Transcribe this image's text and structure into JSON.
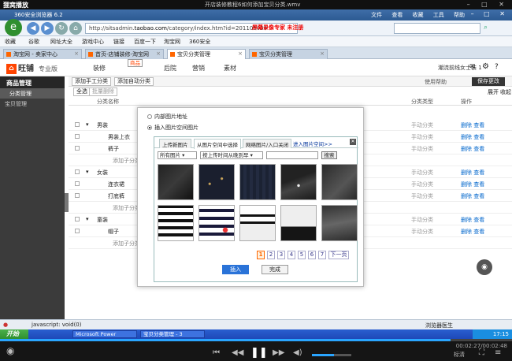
{
  "player": {
    "app_name": "狸窝播放",
    "title": "开店装修教程6如何添加宝贝分类.wmv",
    "time": "00:02:27/00:02:48",
    "progress": 0.88,
    "volume": 0.55,
    "quality_label": "标清"
  },
  "browser": {
    "title": "360安全浏览器 6.2",
    "menu": "文件 查看 收藏 工具 帮助",
    "url_prefix": "http://sitsadmin.",
    "url_host": "taobao.com",
    "url_rest": "/category/index.htm?id=201105038",
    "recording_label": "屏幕录像专家 未注册",
    "favorites": [
      "收藏",
      "谷歌",
      "网址大全",
      "游戏中心",
      "链接",
      "百度一下",
      "淘宝网",
      "360安全"
    ],
    "tabs": [
      {
        "label": "淘宝网 - 卖家中心"
      },
      {
        "label": "首页-店铺装修-淘宝网"
      },
      {
        "label": "宝贝分类管理"
      },
      {
        "label": "宝贝分类管理"
      }
    ]
  },
  "app": {
    "brand": "旺铺",
    "edition": "专业版",
    "nav": [
      "装修",
      "商品",
      "后院",
      "营销",
      "素材"
    ],
    "user": "潮流前线女士装 1",
    "sidebar": {
      "header": "商品管理",
      "items": [
        "分类管理",
        "宝贝管理"
      ]
    },
    "toolbar": {
      "add_manual": "添加手工分类",
      "add_auto": "添加自动分类",
      "help": "使用帮助",
      "save": "保存更改",
      "expand": "展开",
      "collapse": "收起"
    },
    "filter": {
      "all": "全选",
      "batch_delete": "批量删除"
    },
    "columns": {
      "name": "分类名称",
      "type": "分类类型",
      "ops": "操作"
    },
    "rows": [
      {
        "name": "男装",
        "type": "手动分类",
        "ops": "删除 查看"
      },
      {
        "name": "男装上衣",
        "type": "手动分类",
        "ops": "删除 查看"
      },
      {
        "name": "裤子",
        "type": "手动分类",
        "ops": "删除 查看"
      },
      {
        "name": "添加子分类",
        "type": "",
        "ops": ""
      },
      {
        "name": "女装",
        "type": "手动分类",
        "ops": "删除 查看"
      },
      {
        "name": "连衣裙",
        "type": "手动分类",
        "ops": "删除 查看"
      },
      {
        "name": "打底裤",
        "type": "手动分类",
        "ops": "删除 查看"
      },
      {
        "name": "添加子分类",
        "type": "",
        "ops": ""
      },
      {
        "name": "童装",
        "type": "手动分类",
        "ops": "删除 查看"
      },
      {
        "name": "帽子",
        "type": "手动分类",
        "ops": "删除 查看"
      },
      {
        "name": "添加子分类",
        "type": "",
        "ops": ""
      }
    ]
  },
  "dialog": {
    "radio_url": "内部图片地址",
    "radio_space": "插入图片空间图片",
    "tabs": [
      "上传新图片",
      "从图片空间中选择",
      "网络图片/入口关闭",
      "进入图片空间>>"
    ],
    "filter_all": "所有图片",
    "filter_sort": "按上传时间从晚到早",
    "search": "搜索",
    "pages": [
      "1",
      "2",
      "3",
      "4",
      "5",
      "6",
      "7"
    ],
    "next": "下一页",
    "insert": "插入",
    "done": "完成"
  },
  "status": {
    "left": "javascript: void(0)",
    "right": "浏览器医生"
  },
  "taskbar": {
    "start": "开始",
    "tasks": [
      "Microsoft Power",
      "宝贝分类管理 - 3"
    ],
    "clock": "17:15"
  }
}
